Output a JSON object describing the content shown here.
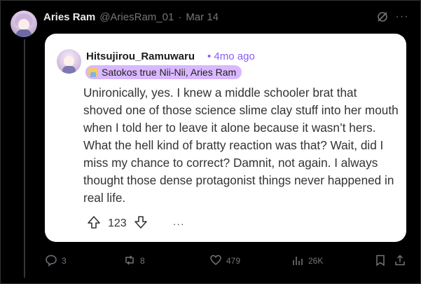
{
  "post": {
    "author_name": "Aries Ram",
    "author_handle": "@AriesRam_01",
    "dot": "·",
    "date": "Mar 14",
    "more": "···"
  },
  "card": {
    "username": "Hitsujirou_Ramuwaru",
    "time": "• 4mo ago",
    "flair": "Satokos true Nii-Nii, Aries Ram",
    "text": "Unironically, yes. I knew a middle schooler brat that shoved one of those science slime clay stuff into her mouth when I told her to leave it alone because it wasn’t hers. What the hell kind of bratty reaction was that? Wait, did I miss my chance to correct? Damnit, not again. I always thought those dense protagonist things never happened in real life.",
    "score": "123",
    "more": "···"
  },
  "toolbar": {
    "replies": "3",
    "reposts": "8",
    "likes": "479",
    "views": "26K"
  },
  "icons": [
    "grok-icon",
    "more-icon",
    "upvote-icon",
    "downvote-icon",
    "reply-icon",
    "repost-icon",
    "like-icon",
    "views-icon",
    "bookmark-icon",
    "share-icon"
  ],
  "colors": {
    "background": "#000000",
    "card": "#ffffff",
    "accent": "#8b5cf6",
    "flair": "#d9b8ff",
    "muted": "#71767b"
  }
}
